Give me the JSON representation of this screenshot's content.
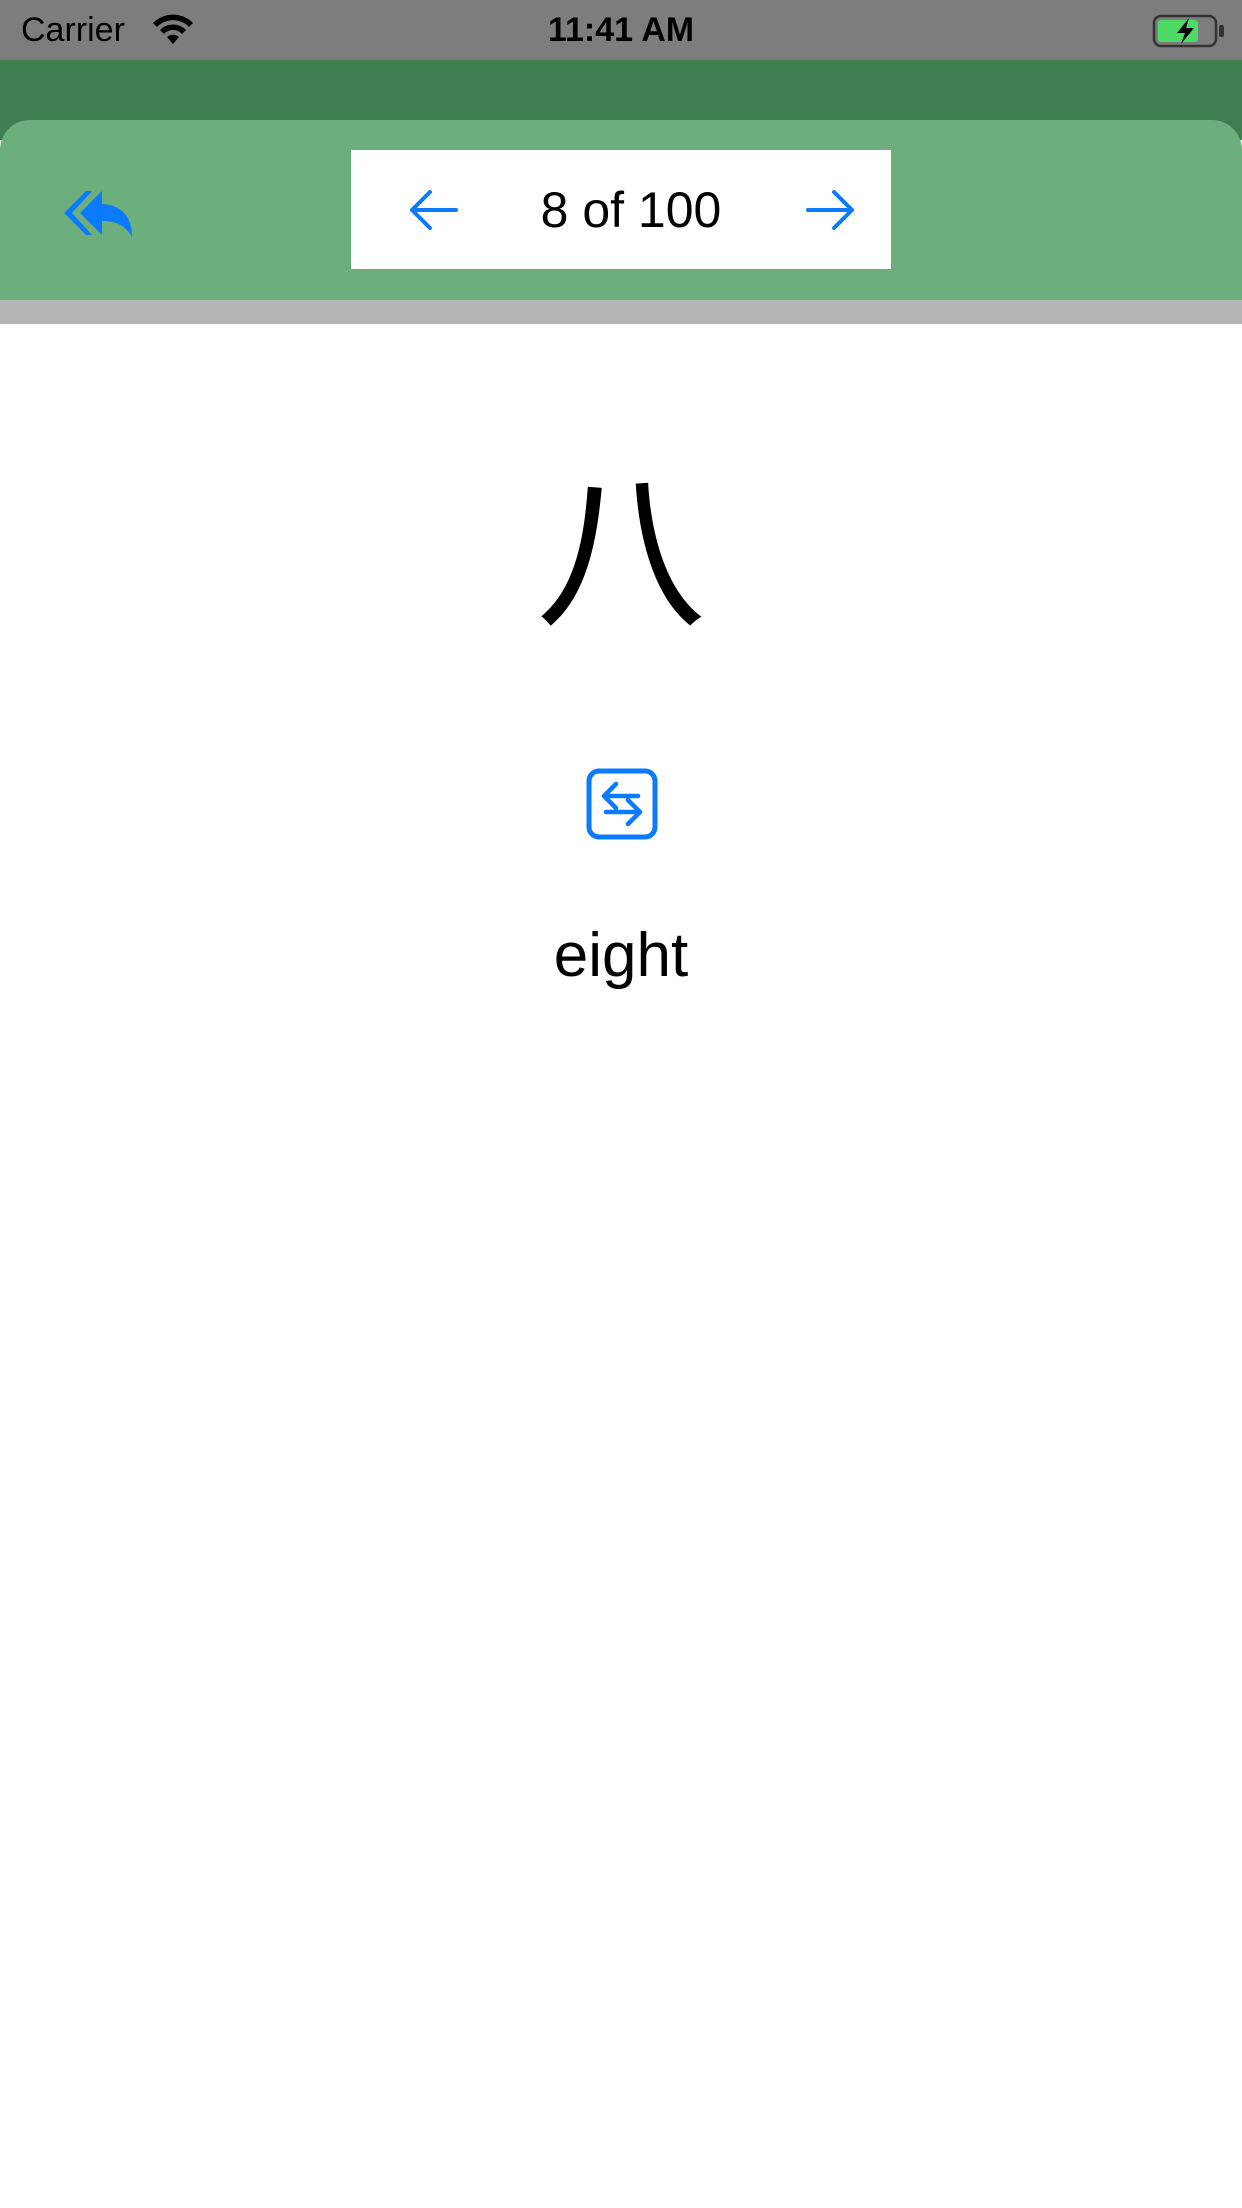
{
  "status_bar": {
    "carrier": "Carrier",
    "time": "11:41 AM",
    "icons": [
      "wifi-icon",
      "battery-charging-icon"
    ]
  },
  "header": {
    "back_icon": "reply-all-icon",
    "pager": {
      "label": "8 of 100",
      "prev_icon": "arrow-left-icon",
      "next_icon": "arrow-right-icon"
    }
  },
  "card": {
    "character": "八",
    "swap_icon": "swap-icon",
    "meaning": "eight"
  },
  "colors": {
    "status_bar": "#7d7d7d",
    "header_dark": "#3f7e4e",
    "header_light": "#6daf7c",
    "accent": "#0a7aff",
    "divider": "#b4b4b4",
    "battery_fill": "#4cd964"
  }
}
